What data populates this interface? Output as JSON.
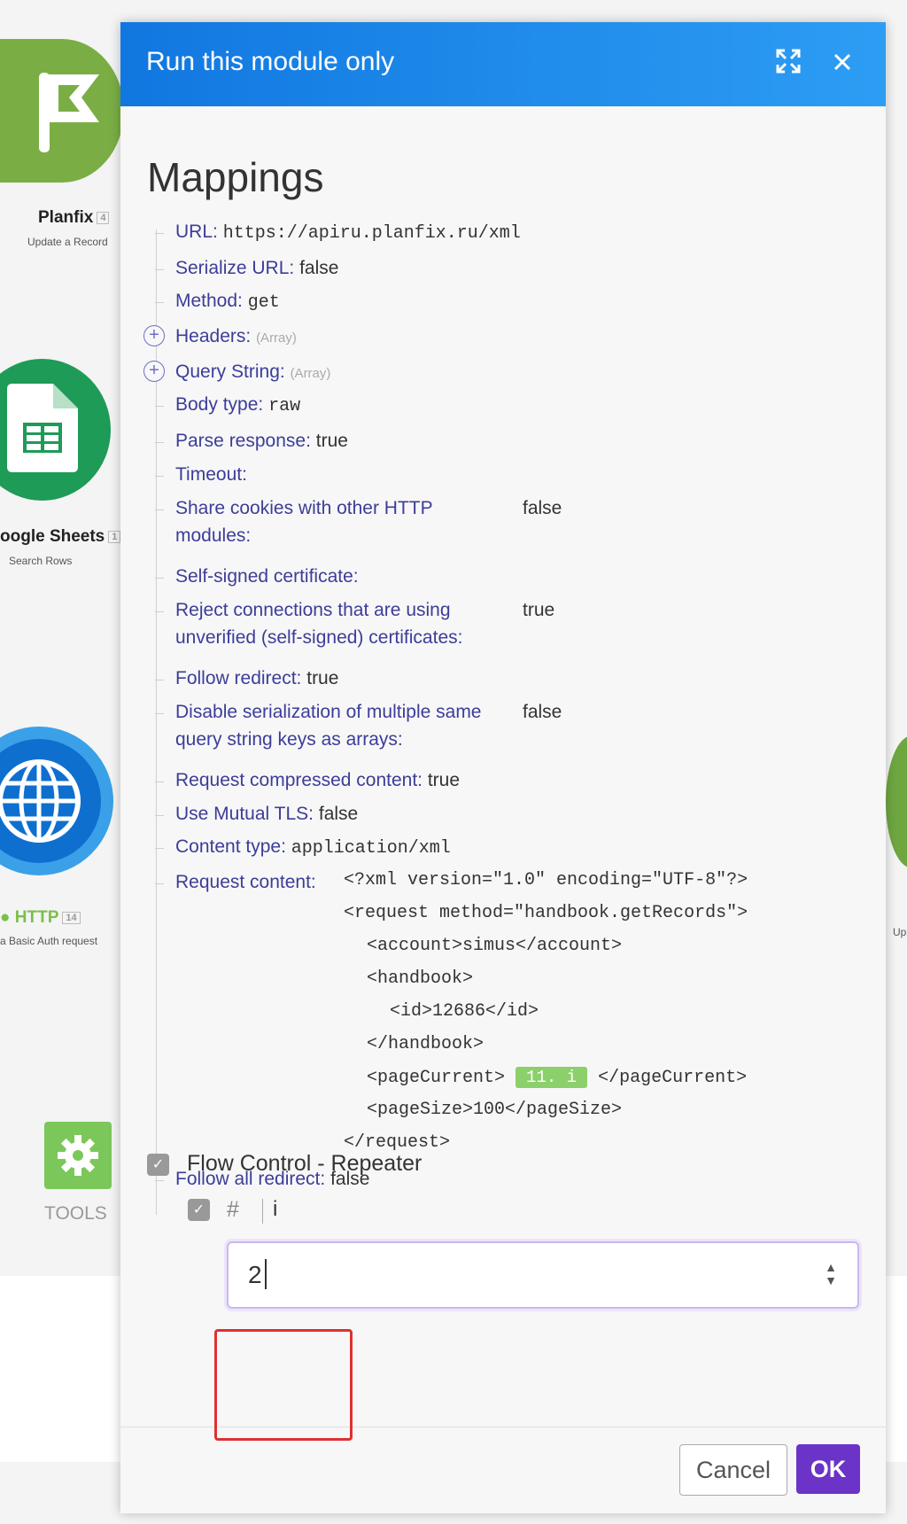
{
  "background": {
    "modules": [
      {
        "name": "Planfix",
        "badge": "4",
        "subtitle": "Update a Record"
      },
      {
        "name": "oogle Sheets",
        "badge": "1",
        "subtitle": "Search Rows"
      },
      {
        "name": "HTTP",
        "badge": "14",
        "subtitle": "a Basic Auth request"
      }
    ],
    "tools_label": "TOOLS",
    "right_edge_label": "Up"
  },
  "dialog": {
    "title": "Run this module only",
    "expand_icon": "expand-icon",
    "close_icon": "close-icon",
    "mappings_title": "Mappings",
    "rows": [
      {
        "key": "URL:",
        "value": "https://apiru.planfix.ru/xml",
        "mono": true
      },
      {
        "key": "Serialize URL:",
        "value": "false"
      },
      {
        "key": "Method:",
        "value": "get",
        "mono": true
      },
      {
        "key": "Headers:",
        "value": "(Array)",
        "expandable": true
      },
      {
        "key": "Query String:",
        "value": "(Array)",
        "expandable": true
      },
      {
        "key": "Body type:",
        "value": "raw",
        "mono": true
      },
      {
        "key": "Parse response:",
        "value": "true"
      },
      {
        "key": "Timeout:",
        "value": ""
      },
      {
        "key": "Share cookies with other HTTP",
        "key2": "modules:",
        "value": "false"
      },
      {
        "key": "Self-signed certificate:",
        "value": ""
      },
      {
        "key": "Reject connections that are using",
        "key2": "unverified (self-signed) certificates:",
        "value": "true"
      },
      {
        "key": "Follow redirect:",
        "value": "true"
      },
      {
        "key": "Disable serialization of multiple same",
        "key2": "query string keys as arrays:",
        "value": "false"
      },
      {
        "key": "Request compressed content:",
        "value": "true"
      },
      {
        "key": "Use Mutual TLS:",
        "value": "false"
      },
      {
        "key": "Content type:",
        "value": "application/xml",
        "mono": true
      },
      {
        "key": "Request content:",
        "value": ""
      }
    ],
    "request_content": {
      "lines": [
        "<?xml version=\"1.0\" encoding=\"UTF-8\"?>",
        "<request method=\"handbook.getRecords\">",
        "<account>simus</account>",
        "<handbook>",
        "<id>12686</id>",
        "</handbook>",
        "<pageCurrent>",
        "</pageCurrent>",
        "<pageSize>100</pageSize>",
        "</request>"
      ],
      "pill": "11. i"
    },
    "last_row": {
      "key": "Follow all redirect:",
      "value": "false"
    },
    "section_title": "Flow Control - Repeater",
    "field_hash": "#",
    "field_label": "i",
    "field_value": "2",
    "cancel_label": "Cancel",
    "ok_label": "OK"
  }
}
